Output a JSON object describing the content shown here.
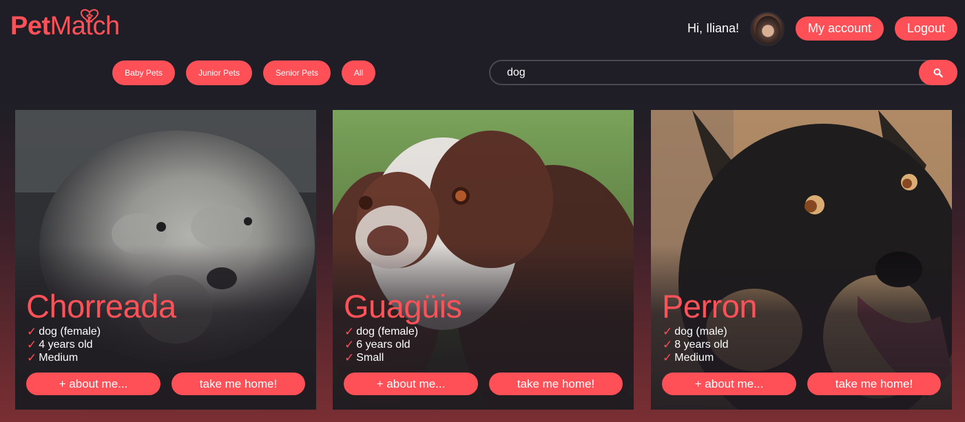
{
  "brand": {
    "part1": "Pet",
    "part2": "Match",
    "color": "#ff5258"
  },
  "header": {
    "greeting": "Hi, Iliana!",
    "account_label": "My account",
    "logout_label": "Logout"
  },
  "filters": [
    {
      "label": "Baby Pets"
    },
    {
      "label": "Junior Pets"
    },
    {
      "label": "Senior Pets"
    },
    {
      "label": "All"
    }
  ],
  "search": {
    "value": "dog",
    "icon": "search-icon"
  },
  "pets": [
    {
      "name": "Chorreada",
      "facts": [
        "dog (female)",
        "4 years old",
        "Medium"
      ],
      "about_label": "+ about me...",
      "adopt_label": "take me home!"
    },
    {
      "name": "Guagüis",
      "facts": [
        "dog (female)",
        "6 years old",
        "Small"
      ],
      "about_label": "+ about me...",
      "adopt_label": "take me home!"
    },
    {
      "name": "Perron",
      "facts": [
        "dog (male)",
        "8 years old",
        "Medium"
      ],
      "about_label": "+ about me...",
      "adopt_label": "take me home!"
    }
  ],
  "colors": {
    "accent": "#ff4f57",
    "background": "#1f1e26"
  }
}
